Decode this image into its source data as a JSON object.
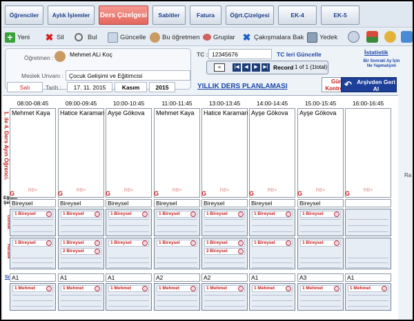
{
  "nav": {
    "items": [
      "Öğrenciler",
      "Aylık İşlemler",
      "Ders Çizelgesi",
      "Sabitler",
      "Fatura",
      "Öğrt.Çizelgesi",
      "EK-4",
      "EK-5"
    ],
    "active": "Ders Çizelgesi"
  },
  "toolbar": {
    "yeni": "Yeni",
    "sil": "Sil",
    "bul": "Bul",
    "guncelle": "Güncelle",
    "bu_ogretmen": "Bu öğretmen",
    "gruplar": "Gruplar",
    "cakismalara_bak": "Çakışmalara Bak",
    "yedek": "Yedek"
  },
  "form": {
    "ogretmen_label": "Öğretmen :",
    "ogretmen_value": "Mehmet ALi Koç",
    "meslek_label": "Meslek Unvanı :",
    "meslek_value": "Çocuk Gelişimi ve Eğitimcisi",
    "gun_value": "Salı",
    "tarih_label": "Tarih :",
    "tarih_value": "17. 11. 2015",
    "ay_value": "Kasım",
    "yil_value": "2015",
    "tc_label": "TC :",
    "tc_value": "12345676",
    "tc_link": "TC leri Güncelle",
    "istatistik": "İstatistik",
    "bir_sonraki": "Bir Sonraki Ay İçin Ne Yapmalıyım",
    "record_label": "Record",
    "record_text": "1 of 1 (1total)",
    "yillik": "YILLIK DERS PLANLAMASI",
    "gun_kontrolu": "Gün Kontrolu",
    "arsivden": "Arşivden Geri Al"
  },
  "schedule": {
    "side_label": "1. ile 4. Ders Ayın Öğrenci.",
    "egitim_sekli_label": "Eğitim Şekli",
    "gunluk_label": "Günlük",
    "haftalik_label": "Haftalık",
    "sinif_label": "Sınıf",
    "g_label": "G",
    "rb_text": "RB=",
    "ra_text": "Ra",
    "slots": [
      {
        "time": "08:00-08:45",
        "teacher": "Mehmet Kaya",
        "sekil": "Bireysel",
        "gunluk": [
          "1 Bireysel"
        ],
        "haftalik": [
          "1 Bireysel"
        ],
        "sinif": "A1",
        "ogrenci": [
          "1 Mehmet"
        ]
      },
      {
        "time": "09:00-09:45",
        "teacher": "Hatice Karaman",
        "sekil": "Bireysel",
        "gunluk": [
          "1 Bireysel"
        ],
        "haftalik": [
          "1 Bireysel",
          "2 Bireysel"
        ],
        "sinif": "A1",
        "ogrenci": [
          "1 Mehmet"
        ]
      },
      {
        "time": "10:00-10:45",
        "teacher": "Ayşe Gökova",
        "sekil": "Bireysel",
        "gunluk": [
          "1 Bireysel"
        ],
        "haftalik": [
          "1 Bireysel"
        ],
        "sinif": "A1",
        "ogrenci": [
          "1 Mehmet"
        ]
      },
      {
        "time": "11:00-11:45",
        "teacher": "Mehmet Kaya",
        "sekil": "Bireysel",
        "gunluk": [
          "1 Bireysel"
        ],
        "haftalik": [
          "1 Bireysel"
        ],
        "sinif": "A2",
        "ogrenci": [
          "1 Mehmet"
        ]
      },
      {
        "time": "13:00-13:45",
        "teacher": "Hatice Karaman",
        "sekil": "Bireysel",
        "gunluk": [
          "1 Bireysel"
        ],
        "haftalik": [
          "1 Bireysel",
          "2 Bireysel"
        ],
        "sinif": "A2",
        "ogrenci": [
          "1 Mehmet"
        ]
      },
      {
        "time": "14:00-14:45",
        "teacher": "Ayşe Gökova",
        "sekil": "Bireysel",
        "gunluk": [
          "1 Bireysel"
        ],
        "haftalik": [
          "1 Bireysel"
        ],
        "sinif": "A1",
        "ogrenci": [
          "1 Mehmet"
        ]
      },
      {
        "time": "15:00-15:45",
        "teacher": "Ayşe Gökova",
        "sekil": "Bireysel",
        "gunluk": [
          "1 Bireysel"
        ],
        "haftalik": [
          "1 Bireysel"
        ],
        "sinif": "A3",
        "ogrenci": [
          "1 Mehmet"
        ]
      },
      {
        "time": "16:00-16:45",
        "teacher": "",
        "sekil": "",
        "gunluk": [],
        "haftalik": [],
        "sinif": "A1",
        "ogrenci": [
          "1 Mehmet"
        ]
      }
    ]
  },
  "colors": {
    "accent": "#e3665d",
    "link": "#1a46a8",
    "label_red": "#c81b1b",
    "archive": "#1c3f9a"
  }
}
